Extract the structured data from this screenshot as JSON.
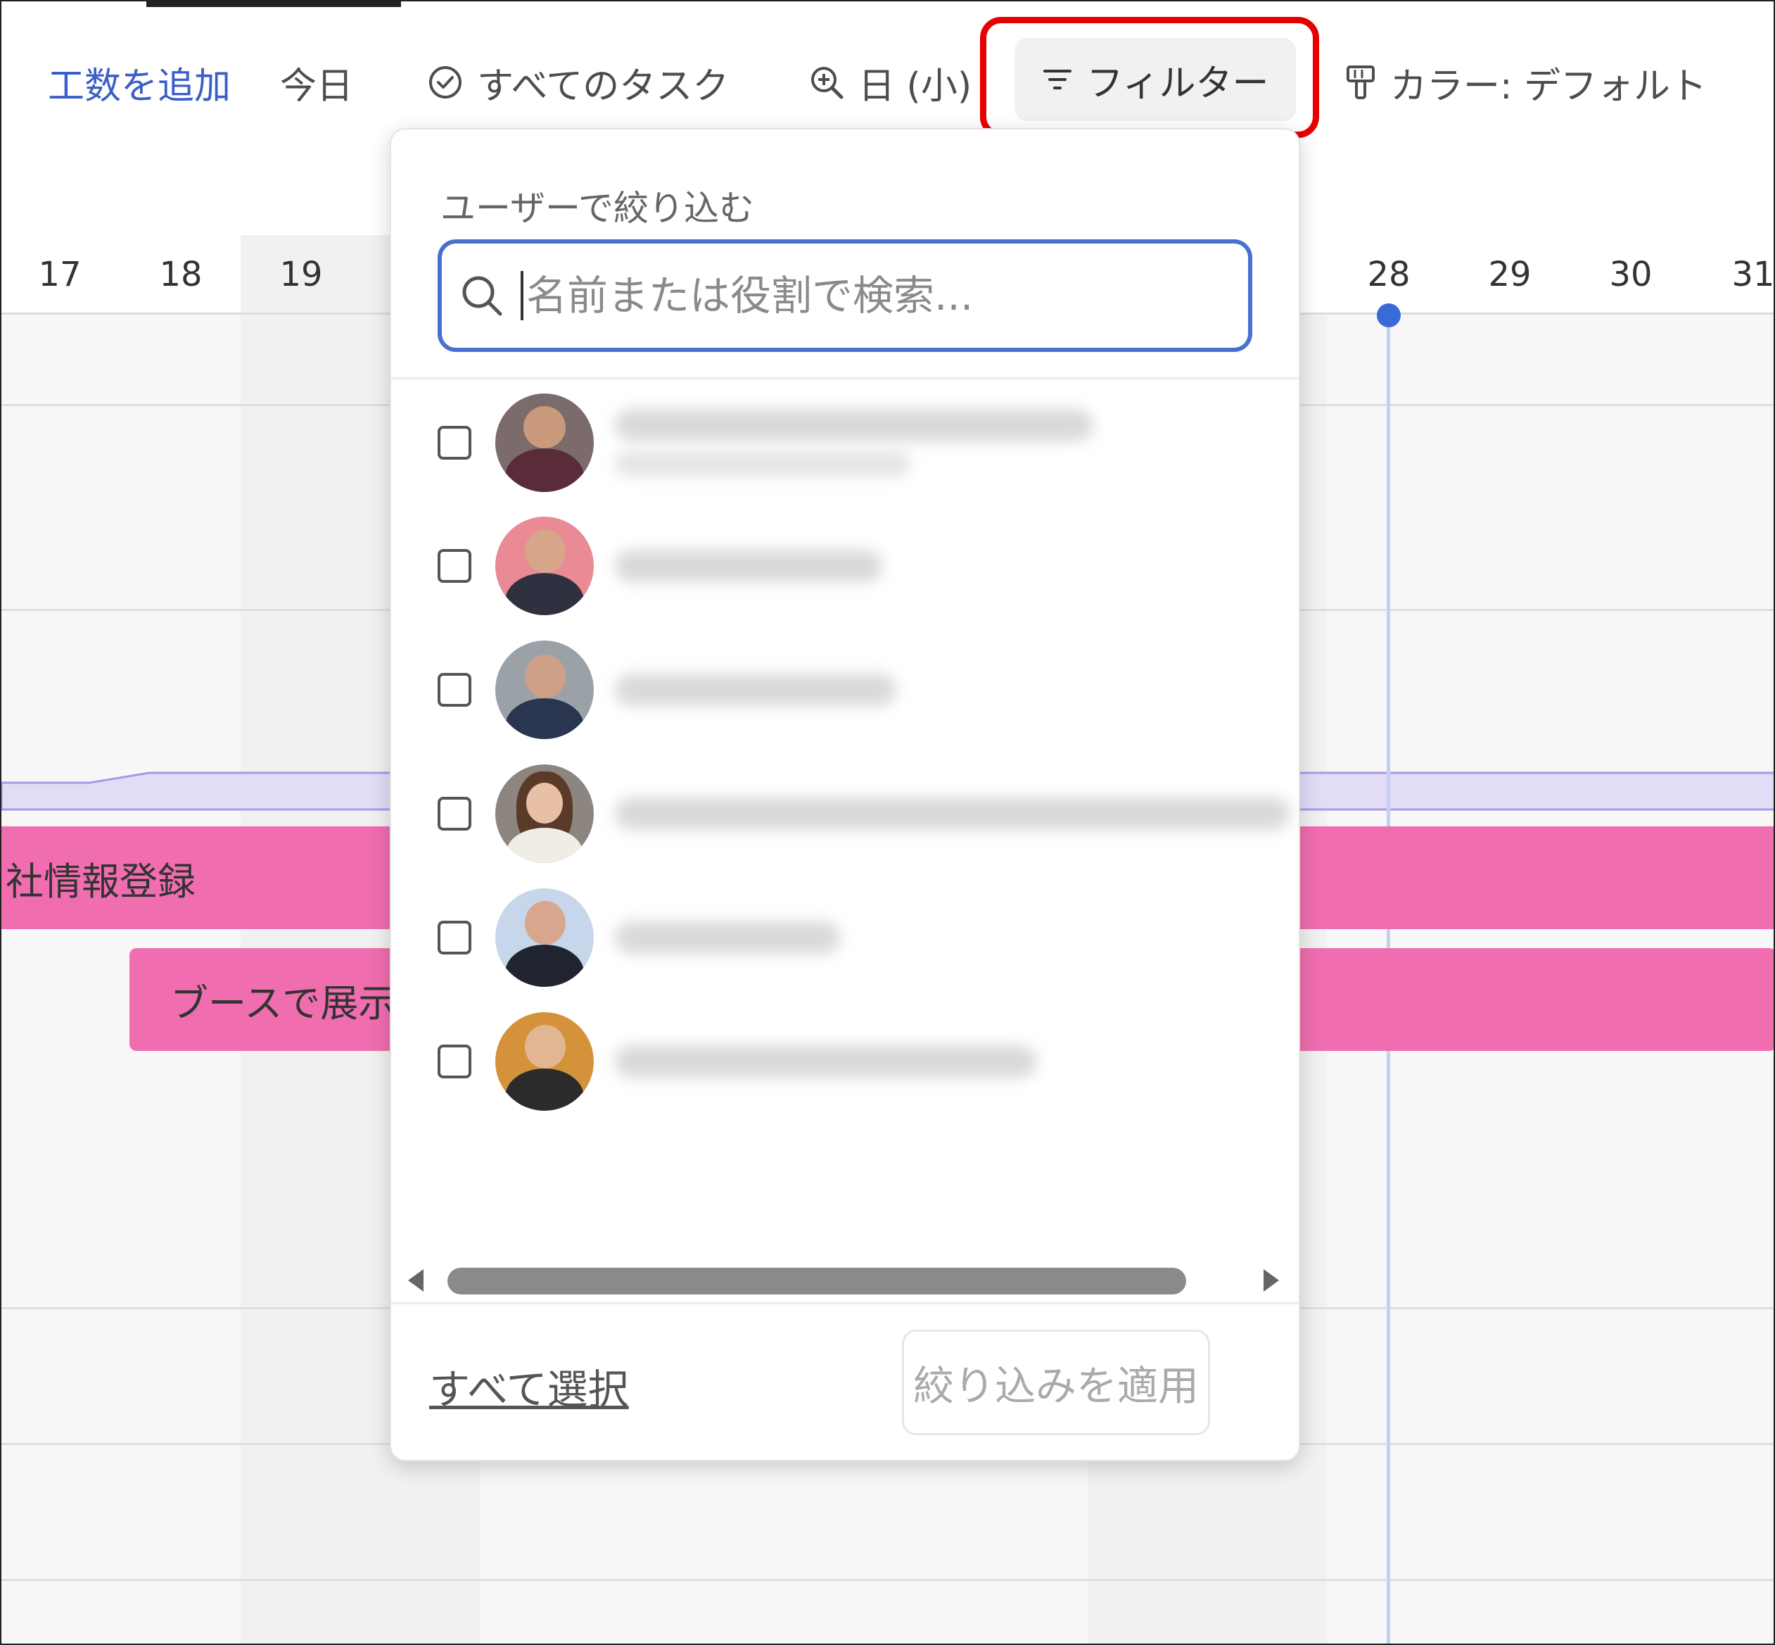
{
  "toolbar": {
    "add_hours_label": "工数を追加",
    "today_label": "今日",
    "all_tasks_label": "すべてのタスク",
    "zoom_label": "日 (小)",
    "filter_label": "フィルター",
    "color_label": "カラー: デフォルト"
  },
  "calendar": {
    "days_left": [
      "17",
      "18",
      "19"
    ],
    "days_right": [
      "28",
      "29",
      "30",
      "31"
    ],
    "today_day": "28",
    "accent_color": "#3a6ad8",
    "task_color": "#f06daf",
    "tasks": [
      {
        "label": "社情報登録"
      },
      {
        "label": "ブースで展示"
      }
    ]
  },
  "filter_dropdown": {
    "section_label": "ユーザーで絞り込む",
    "search_placeholder": "名前または役割で検索...",
    "search_value": "",
    "users": [
      {
        "checked": false,
        "name_blurred": true,
        "has_role": true,
        "avatar_bg": "#7b6b6b"
      },
      {
        "checked": false,
        "name_blurred": true,
        "has_role": false,
        "avatar_bg": "#e98a95"
      },
      {
        "checked": false,
        "name_blurred": true,
        "has_role": false,
        "avatar_bg": "#9aa2a8"
      },
      {
        "checked": false,
        "name_blurred": true,
        "has_role": false,
        "avatar_bg": "#8d8580"
      },
      {
        "checked": false,
        "name_blurred": true,
        "has_role": false,
        "avatar_bg": "#c7d6ea"
      },
      {
        "checked": false,
        "name_blurred": true,
        "has_role": false,
        "avatar_bg": "#d4933b"
      }
    ],
    "select_all_label": "すべて選択",
    "apply_label": "絞り込みを適用"
  }
}
